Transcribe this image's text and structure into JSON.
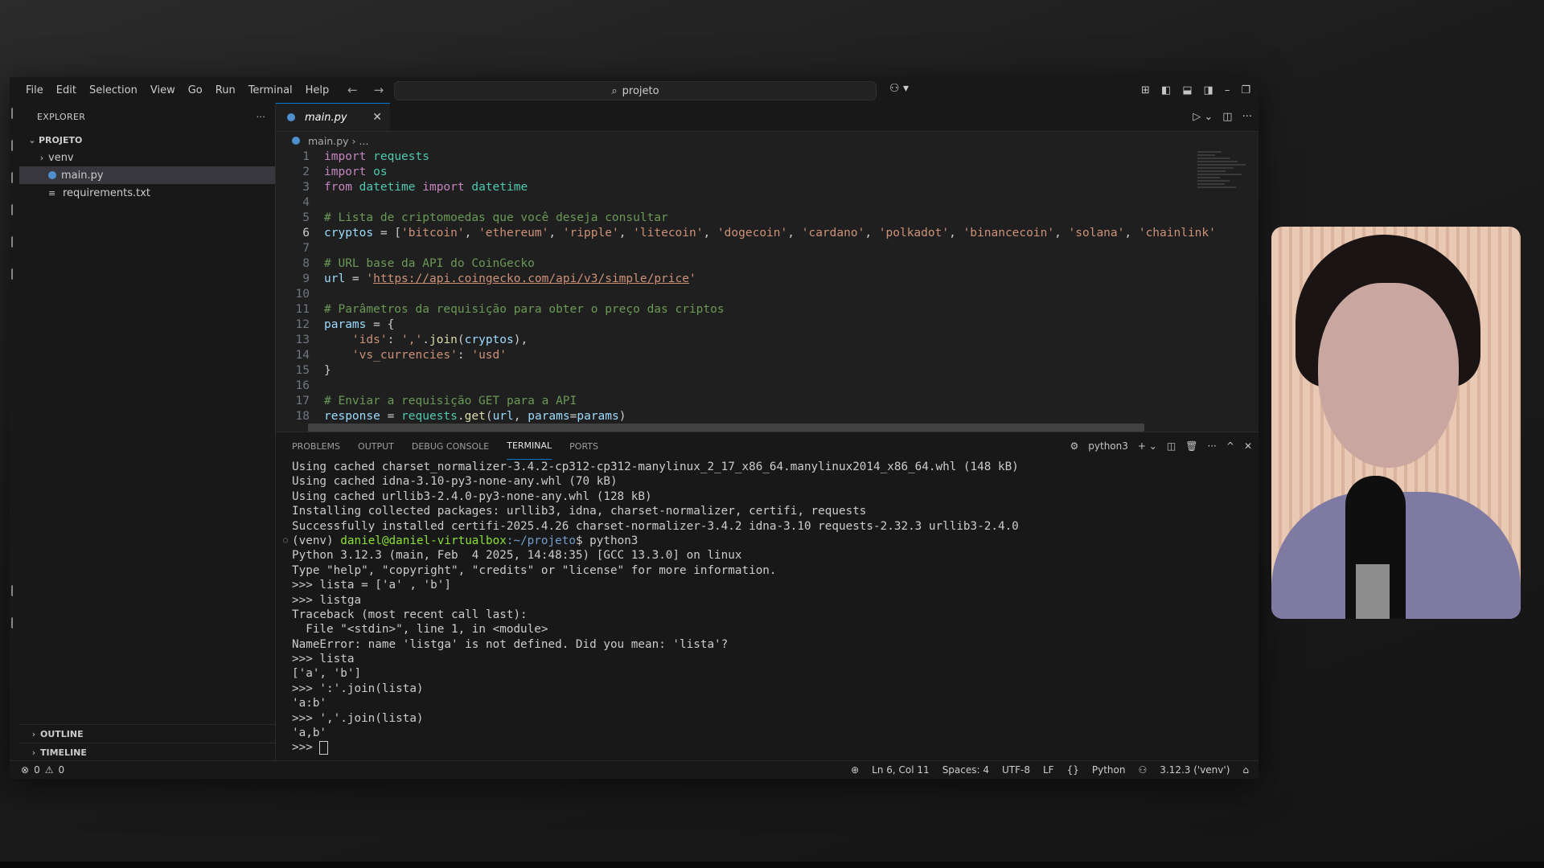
{
  "window": {
    "menu": [
      "File",
      "Edit",
      "Selection",
      "View",
      "Go",
      "Run",
      "Terminal",
      "Help"
    ],
    "search_text": "projeto"
  },
  "explorer": {
    "header": "EXPLORER",
    "more": "···",
    "root": "PROJETO",
    "items": [
      {
        "label": "venv",
        "type": "folder"
      },
      {
        "label": "main.py",
        "type": "python"
      },
      {
        "label": "requirements.txt",
        "type": "text"
      }
    ],
    "outline": "OUTLINE",
    "timeline": "TIMELINE"
  },
  "editor": {
    "tab_label": "main.py",
    "tab_close": "✕",
    "breadcrumb": [
      "main.py",
      "..."
    ],
    "active_line": 6
  },
  "panel": {
    "tabs": [
      "PROBLEMS",
      "OUTPUT",
      "DEBUG CONSOLE",
      "TERMINAL",
      "PORTS"
    ],
    "active_tab": "TERMINAL",
    "shell": "python3",
    "terminal_lines": [
      "Using cached charset_normalizer-3.4.2-cp312-cp312-manylinux_2_17_x86_64.manylinux2014_x86_64.whl (148 kB)",
      "Using cached idna-3.10-py3-none-any.whl (70 kB)",
      "Using cached urllib3-2.4.0-py3-none-any.whl (128 kB)",
      "Installing collected packages: urllib3, idna, charset-normalizer, certifi, requests",
      "Successfully installed certifi-2025.4.26 charset-normalizer-3.4.2 idna-3.10 requests-2.32.3 urllib3-2.4.0",
      "PROMPT",
      "Python 3.12.3 (main, Feb  4 2025, 14:48:35) [GCC 13.3.0] on linux",
      "Type \"help\", \"copyright\", \"credits\" or \"license\" for more information.",
      ">>> lista = ['a' , 'b']",
      ">>> listga",
      "Traceback (most recent call last):",
      "  File \"<stdin>\", line 1, in <module>",
      "NameError: name 'listga' is not defined. Did you mean: 'lista'?",
      ">>> lista",
      "['a', 'b']",
      ">>> ':'.join(lista)",
      "'a:b'",
      ">>> ','.join(lista)",
      "'a,b'"
    ],
    "prompt": {
      "venv": "(venv) ",
      "user": "daniel@daniel-virtualbox",
      "path": ":~/projeto",
      "cmd": "$ python3"
    },
    "last_prompt": ">>> "
  },
  "status": {
    "errors": "0",
    "warnings": "0",
    "position": "Ln 6, Col 11",
    "spaces": "Spaces: 4",
    "encoding": "UTF-8",
    "eol": "LF",
    "language": "Python",
    "interpreter": "3.12.3 ('venv')"
  }
}
